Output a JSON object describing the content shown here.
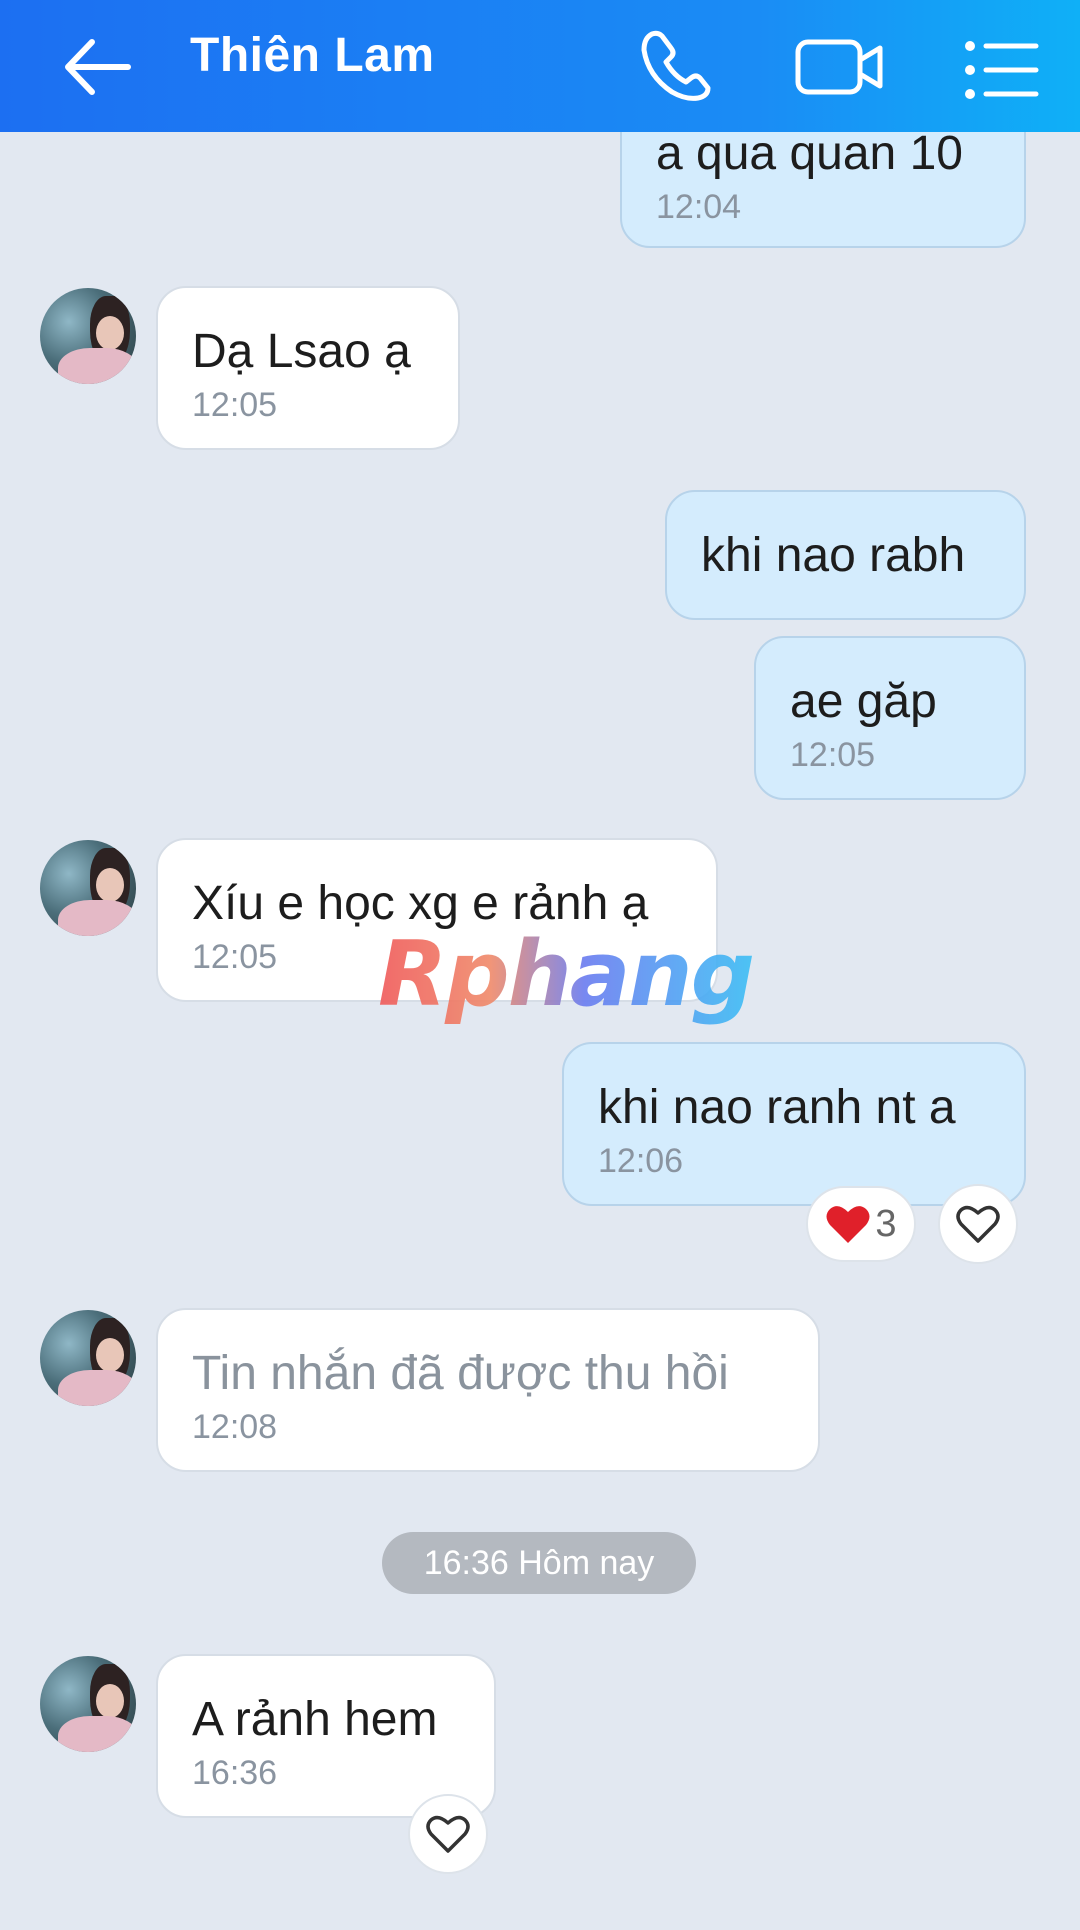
{
  "header": {
    "title": "Thiên Lam",
    "back_icon": "arrow-left-icon",
    "call_icon": "phone-icon",
    "video_icon": "video-camera-icon",
    "menu_icon": "list-menu-icon"
  },
  "messages": [
    {
      "side": "out",
      "text": "a qua quan 10",
      "time": "12:04"
    },
    {
      "side": "in",
      "text": "Dạ Lsao ạ",
      "time": "12:05"
    },
    {
      "side": "out",
      "text": "khi nao rabh",
      "time": ""
    },
    {
      "side": "out",
      "text": "ae găp",
      "time": "12:05"
    },
    {
      "side": "in",
      "text": "Xíu e học xg e rảnh ạ",
      "time": "12:05"
    },
    {
      "side": "out",
      "text": "khi nao ranh nt a",
      "time": "12:06",
      "reaction_count": "3"
    },
    {
      "side": "in",
      "text": "Tin nhắn đã được thu hồi",
      "time": "12:08",
      "recalled": true
    },
    {
      "side": "in",
      "text": "A rảnh hem",
      "time": "16:36"
    }
  ],
  "date_separator": "16:36 Hôm nay",
  "watermark": "Rphang",
  "colors": {
    "header_start": "#1c6ff2",
    "header_end": "#0fb0f7",
    "outgoing_bubble": "#d4ecfd",
    "incoming_bubble": "#ffffff",
    "background": "#e2e8f1",
    "reaction_heart": "#e0202a"
  }
}
